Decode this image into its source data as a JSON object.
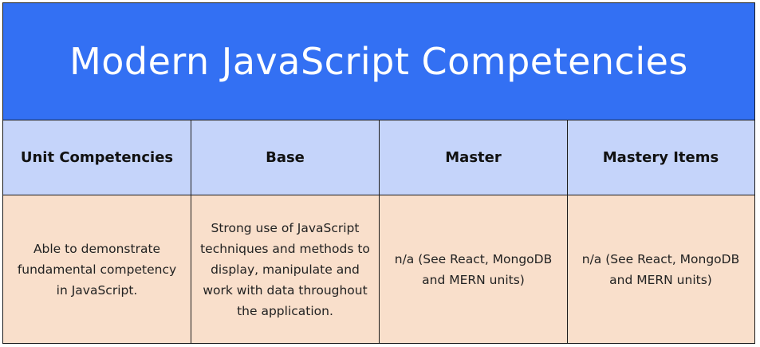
{
  "title": "Modern JavaScript Competencies",
  "table": {
    "headers": [
      "Unit Competencies",
      "Base",
      "Master",
      "Mastery Items"
    ],
    "row": [
      "Able to demonstrate fundamental competency in JavaScript.",
      "Strong use of JavaScript techniques and methods to display, manipulate and work with data throughout the application.",
      "n/a (See React, MongoDB and MERN units)",
      "n/a (See React, MongoDB and MERN units)"
    ]
  },
  "colors": {
    "title_bg": "#3370f3",
    "header_bg": "#c5d4fa",
    "body_bg": "#f9dfcb",
    "border": "#1c1c1c"
  }
}
